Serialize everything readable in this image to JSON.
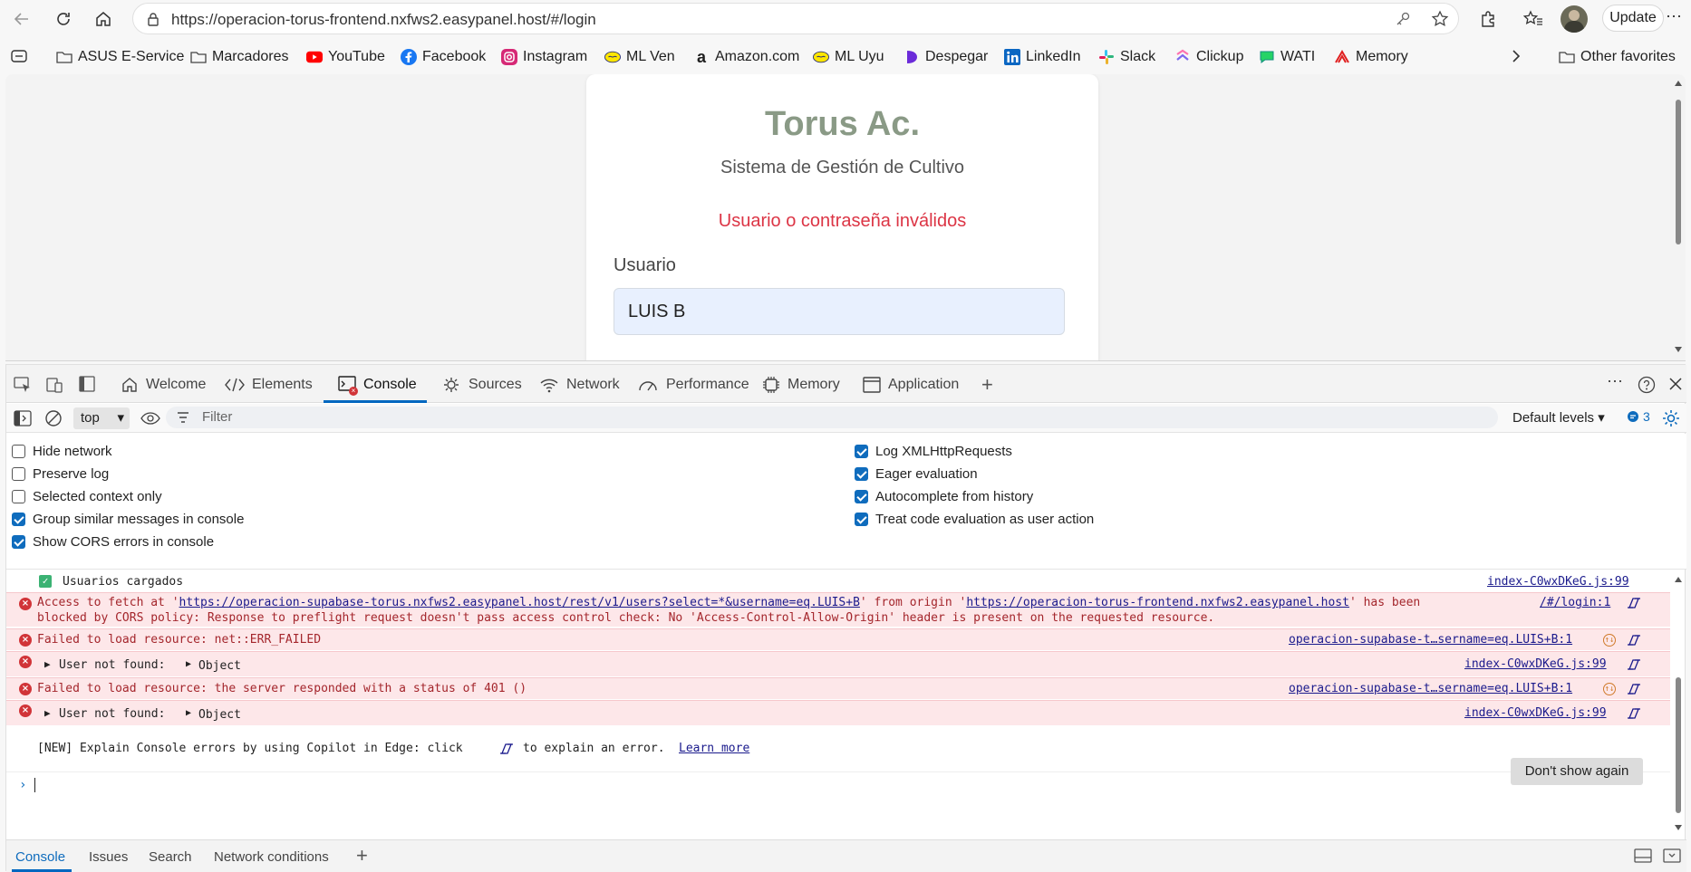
{
  "browser": {
    "url": "https://operacion-torus-frontend.nxfws2.easypanel.host/#/login",
    "update_label": "Update"
  },
  "favorites": [
    {
      "label": "ASUS E-Service",
      "icon": "folder-icon"
    },
    {
      "label": "Marcadores",
      "icon": "folder-icon"
    },
    {
      "label": "YouTube",
      "icon": "youtube-icon"
    },
    {
      "label": "Facebook",
      "icon": "facebook-icon"
    },
    {
      "label": "Instagram",
      "icon": "instagram-icon"
    },
    {
      "label": "ML Ven",
      "icon": "mercadolibre-icon"
    },
    {
      "label": "Amazon.com",
      "icon": "amazon-icon"
    },
    {
      "label": "ML Uyu",
      "icon": "mercadolibre-icon"
    },
    {
      "label": "Despegar",
      "icon": "despegar-icon"
    },
    {
      "label": "LinkedIn",
      "icon": "linkedin-icon"
    },
    {
      "label": "Slack",
      "icon": "slack-icon"
    },
    {
      "label": "Clickup",
      "icon": "clickup-icon"
    },
    {
      "label": "WATI",
      "icon": "wati-icon"
    },
    {
      "label": "Memory",
      "icon": "memory-icon"
    },
    {
      "label": "Other favorites",
      "icon": "folder-icon"
    }
  ],
  "page": {
    "brand": "Torus Ac.",
    "subtitle": "Sistema de Gestión de Cultivo",
    "error": "Usuario o contraseña inválidos",
    "user_label": "Usuario",
    "user_value": "LUIS B"
  },
  "devtools": {
    "tabs": [
      "Welcome",
      "Elements",
      "Console",
      "Sources",
      "Network",
      "Performance",
      "Memory",
      "Application"
    ],
    "active_tab": "Console",
    "context": "top",
    "filter_placeholder": "Filter",
    "levels": "Default levels",
    "issues_count": "3",
    "settings_left": [
      {
        "label": "Hide network",
        "checked": false
      },
      {
        "label": "Preserve log",
        "checked": false
      },
      {
        "label": "Selected context only",
        "checked": false
      },
      {
        "label": "Group similar messages in console",
        "checked": true
      },
      {
        "label": "Show CORS errors in console",
        "checked": true
      }
    ],
    "settings_right": [
      {
        "label": "Log XMLHttpRequests",
        "checked": true
      },
      {
        "label": "Eager evaluation",
        "checked": true
      },
      {
        "label": "Autocomplete from history",
        "checked": true
      },
      {
        "label": "Treat code evaluation as user action",
        "checked": true
      }
    ],
    "console": {
      "info_msg": "Usuarios cargados",
      "info_src": "index-C0wxDKeG.js:99",
      "cors_pre": "Access to fetch at '",
      "cors_url1": "https://operacion-supabase-torus.nxfws2.easypanel.host/rest/v1/users?select=*&username=eq.LUIS+B",
      "cors_mid": "' from origin '",
      "cors_url2": "https://operacion-torus-frontend.nxfws2.easypanel.host",
      "cors_post": "' has been",
      "cors_line2": "blocked by CORS policy: Response to preflight request doesn't pass access control check: No 'Access-Control-Allow-Origin' header is present on the requested resource.",
      "cors_src": "/#/login:1",
      "fail1_msg": "Failed to load resource: net::ERR_FAILED",
      "fail1_src": "operacion-supabase-t…sername=eq.LUIS+B:1",
      "notfound1_msg": "User not found:",
      "notfound1_obj": "Object",
      "notfound1_src": "index-C0wxDKeG.js:99",
      "fail2_msg": "Failed to load resource: the server responded with a status of 401 ()",
      "fail2_src": "operacion-supabase-t…sername=eq.LUIS+B:1",
      "notfound2_msg": "User not found:",
      "notfound2_obj": "Object",
      "notfound2_src": "index-C0wxDKeG.js:99",
      "new_pre": "[NEW] Explain Console errors by using Copilot in Edge: click",
      "new_post": "to explain an error.",
      "learn_more": "Learn more",
      "dont_show": "Don't show again"
    },
    "drawer_tabs": [
      "Console",
      "Issues",
      "Search",
      "Network conditions"
    ]
  }
}
